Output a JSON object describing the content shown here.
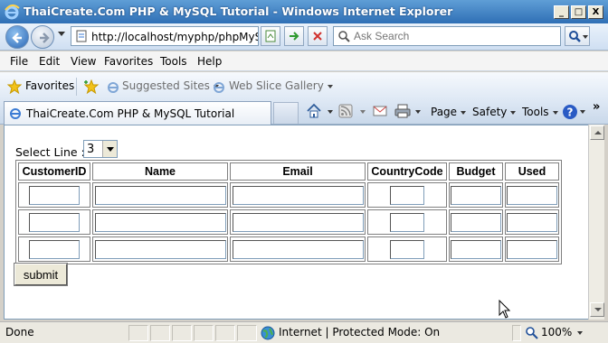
{
  "window": {
    "title": "ThaiCreate.Com PHP & MySQL Tutorial - Windows Internet Explorer",
    "minimize": "_",
    "maximize": "□",
    "close": "X"
  },
  "address": {
    "url": "http://localhost/myphp/phpMySQ",
    "search_placeholder": "Ask Search"
  },
  "menu": [
    "File",
    "Edit",
    "View",
    "Favorites",
    "Tools",
    "Help"
  ],
  "favorites_bar": {
    "favorites": "Favorites",
    "suggested_sites": "Suggested Sites",
    "web_slice_gallery": "Web Slice Gallery"
  },
  "tab": {
    "title": "ThaiCreate.Com PHP & MySQL Tutorial"
  },
  "command_bar": {
    "page": "Page",
    "safety": "Safety",
    "tools": "Tools"
  },
  "form": {
    "select_label": "Select Line :",
    "select_value": "3",
    "columns": [
      "CustomerID",
      "Name",
      "Email",
      "CountryCode",
      "Budget",
      "Used"
    ],
    "row_count": 3,
    "submit_label": "submit"
  },
  "status": {
    "text": "Done",
    "zone": "Internet | Protected Mode: On",
    "zoom": "100%"
  },
  "colors": {
    "titlebar": "#2f6fb5",
    "chrome": "#dfe9f5",
    "status_bar": "#ebe9e1"
  }
}
